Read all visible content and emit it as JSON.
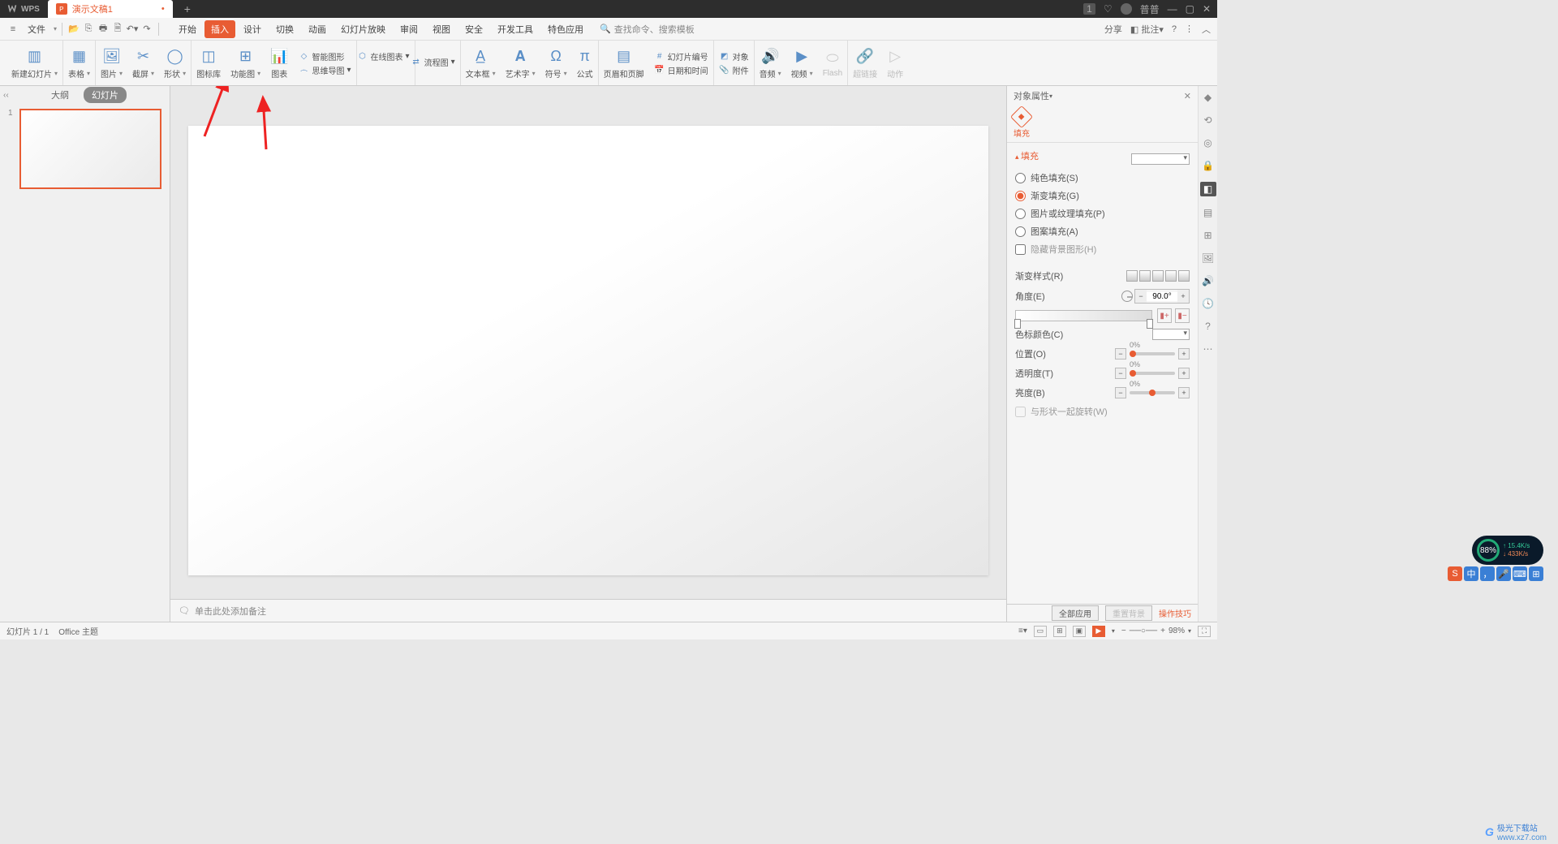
{
  "titlebar": {
    "app": "WPS",
    "doc": "演示文稿1",
    "badge": "1",
    "user": "普普"
  },
  "menu": {
    "file": "文件",
    "tabs": [
      "开始",
      "插入",
      "设计",
      "切换",
      "动画",
      "幻灯片放映",
      "审阅",
      "视图",
      "安全",
      "开发工具",
      "特色应用"
    ],
    "active": "插入",
    "search_ph": "查找命令、搜索模板",
    "share": "分享",
    "annotate": "批注"
  },
  "ribbon": {
    "new_slide": "新建幻灯片",
    "table": "表格",
    "picture": "图片",
    "screenshot": "截屏",
    "shapes": "形状",
    "icon_lib": "图标库",
    "func_chart": "功能图",
    "chart": "图表",
    "smart": "智能图形",
    "online_chart": "在线图表",
    "flow": "流程图",
    "mind": "思维导图",
    "textbox": "文本框",
    "wordart": "艺术字",
    "symbol": "符号",
    "formula": "公式",
    "header": "页眉和页脚",
    "slide_no": "幻灯片编号",
    "datetime": "日期和时间",
    "object": "对象",
    "attach": "附件",
    "audio": "音频",
    "video": "视频",
    "flash": "Flash",
    "hyperlink": "超链接",
    "action": "动作"
  },
  "left": {
    "outline": "大纲",
    "slides": "幻灯片",
    "thumb_num": "1"
  },
  "notes_ph": "单击此处添加备注",
  "props": {
    "title": "对象属性",
    "tab_fill": "填充",
    "sec_fill": "填充",
    "r_solid": "纯色填充(S)",
    "r_grad": "渐变填充(G)",
    "r_pic": "图片或纹理填充(P)",
    "r_pat": "图案填充(A)",
    "c_hide": "隐藏背景图形(H)",
    "grad_style": "渐变样式(R)",
    "angle": "角度(E)",
    "angle_val": "90.0°",
    "stop_color": "色标颜色(C)",
    "position": "位置(O)",
    "pos_val": "0%",
    "opacity": "透明度(T)",
    "op_val": "0%",
    "brightness": "亮度(B)",
    "br_val": "0%",
    "rotate_chk": "与形状一起旋转(W)"
  },
  "footer": {
    "apply_all": "全部应用",
    "reset_bg": "重置背景",
    "tips": "操作技巧"
  },
  "status": {
    "slide": "幻灯片 1 / 1",
    "theme": "Office 主题",
    "zoom": "98%"
  },
  "gauge": {
    "pct": "88%",
    "up": "15.4K/s",
    "dn": "433K/s"
  },
  "ime": {
    "zh": "中"
  },
  "watermark": {
    "site": "极光下载站",
    "url": "www.xz7.com"
  }
}
